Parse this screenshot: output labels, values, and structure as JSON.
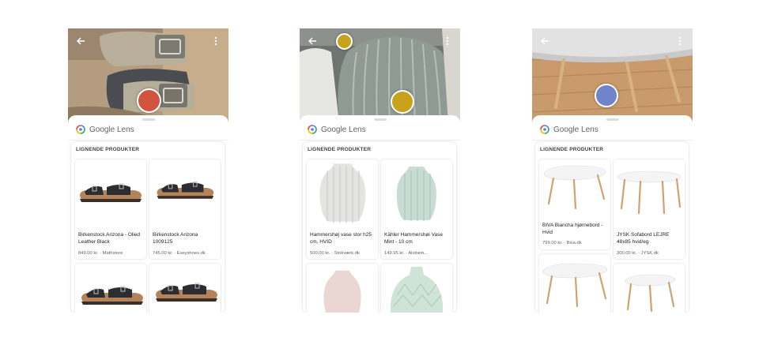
{
  "brand": {
    "name": "Google Lens"
  },
  "section_label": "LIGNENDE PRODUKTER",
  "colors": {
    "shoe_dot": "#d2543f",
    "vase_dot": "#c9a21c",
    "table_dot": "#6f84c9"
  },
  "screens": [
    {
      "subject": "shoes",
      "products": [
        {
          "name": "Birkenstock Arizona - Olied Leather Black",
          "price": "849.00 kr.",
          "store": "Mathstore"
        },
        {
          "name": "Birkenstock Arizona 1009125",
          "price": "745.00 kr.",
          "store": "Easyshoes.dk"
        },
        {
          "name": "",
          "price": "",
          "store": ""
        },
        {
          "name": "",
          "price": "",
          "store": ""
        }
      ]
    },
    {
      "subject": "vase",
      "products": [
        {
          "name": "Hammershøj vase stor h25 cm, HVID",
          "price": "500.00 kr.",
          "store": "Stokværk.dk"
        },
        {
          "name": "Kähler Hammershøi Vase Mint - 10 cm",
          "price": "149.95 kr.",
          "store": "Alstrøm..."
        },
        {
          "name": "",
          "price": "",
          "store": ""
        },
        {
          "name": "",
          "price": "",
          "store": ""
        }
      ]
    },
    {
      "subject": "table",
      "products": [
        {
          "name": "BIVA Biancha hjørnebord - Hvid",
          "price": "799.00 kr.",
          "store": "Biva.dk"
        },
        {
          "name": "JYSK Sofabord LEJRE 48x85 hvid/eg",
          "price": "300.00 kr.",
          "store": "JYSK.dk"
        },
        {
          "name": "",
          "price": "",
          "store": ""
        },
        {
          "name": "",
          "price": "",
          "store": ""
        }
      ]
    }
  ]
}
